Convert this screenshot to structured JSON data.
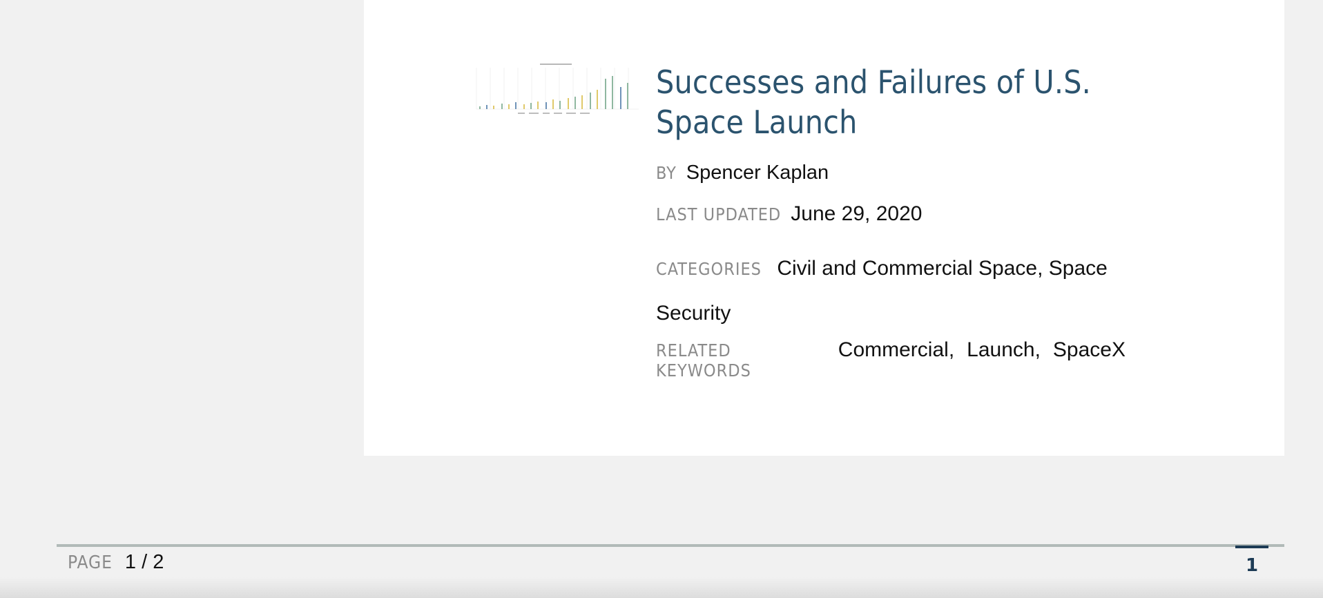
{
  "article": {
    "title": "Successes and Failures of U.S. Space Launch",
    "by_label": "BY",
    "author": "Spencer Kaplan",
    "updated_label": "LAST UPDATED",
    "updated_date": "June 29, 2020",
    "categories_label": "CATEGORIES",
    "categories": "Civil and Commercial Space, Space Security",
    "keywords_label": "RELATED KEYWORDS",
    "keywords": [
      "Commercial,",
      "Launch,",
      "SpaceX"
    ]
  },
  "pager": {
    "label": "PAGE",
    "count": "1 / 2",
    "current_tab": "1"
  },
  "colors": {
    "title": "#2b536e",
    "accent": "#1d3b55",
    "label": "#8a8a8a",
    "rule": "#b1bab8"
  }
}
